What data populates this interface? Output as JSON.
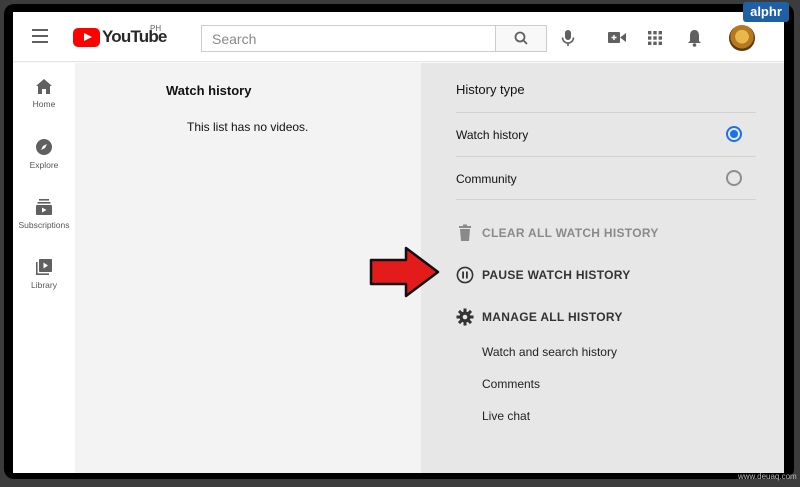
{
  "header": {
    "logo_text": "YouTube",
    "country_code": "PH",
    "search_placeholder": "Search"
  },
  "sidebar": {
    "items": [
      {
        "label": "Home",
        "icon": "home-icon"
      },
      {
        "label": "Explore",
        "icon": "compass-icon"
      },
      {
        "label": "Subscriptions",
        "icon": "subscriptions-icon"
      },
      {
        "label": "Library",
        "icon": "library-icon"
      }
    ]
  },
  "main": {
    "title": "Watch history",
    "empty_message": "This list has no videos."
  },
  "history_panel": {
    "heading": "History type",
    "options": [
      {
        "label": "Watch history",
        "selected": true
      },
      {
        "label": "Community",
        "selected": false
      }
    ],
    "actions": {
      "clear": "CLEAR ALL WATCH HISTORY",
      "pause": "PAUSE WATCH HISTORY",
      "manage": "MANAGE ALL HISTORY"
    },
    "manage_links": [
      "Watch and search history",
      "Comments",
      "Live chat"
    ]
  },
  "overlay": {
    "badge": "alphr",
    "watermark": "www.deuaq.com"
  },
  "colors": {
    "brand_red": "#ff0000",
    "radio_selected": "#1a73e8",
    "arrow_red": "#e31b1b",
    "badge_blue": "#1f5fa3"
  }
}
